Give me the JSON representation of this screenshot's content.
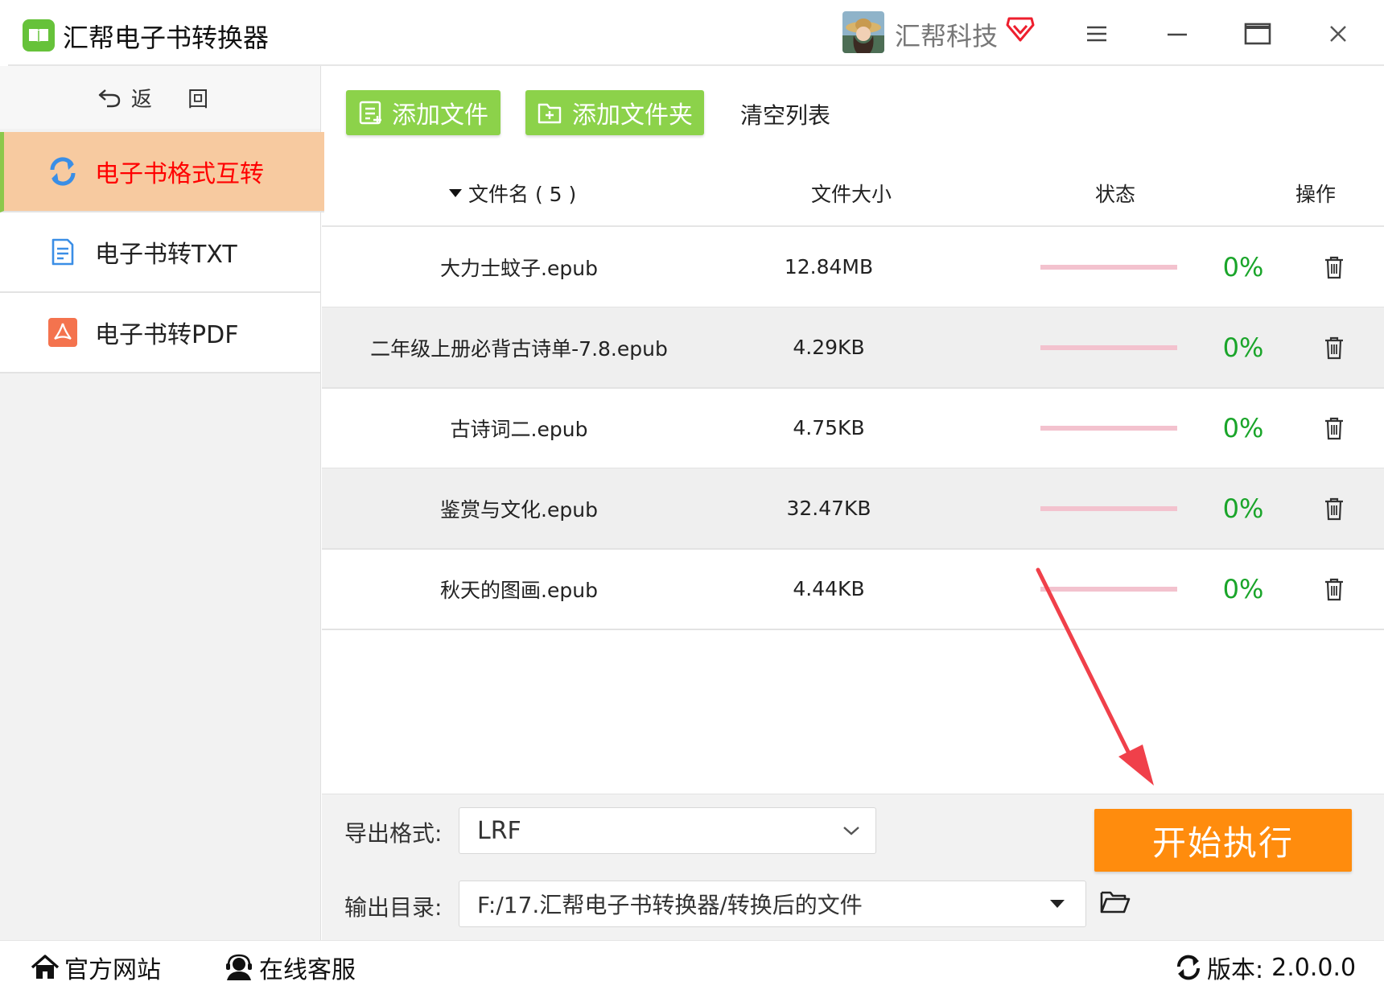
{
  "app": {
    "title": "汇帮电子书转换器",
    "brand_name": "汇帮科技",
    "accent_color": "#8cd24a",
    "highlight_color": "#ff8c0d"
  },
  "sidebar": {
    "back_label": "返 回",
    "items": [
      {
        "label": "电子书格式互转",
        "icon": "refresh-icon",
        "active": true
      },
      {
        "label": "电子书转TXT",
        "icon": "document-icon",
        "active": false
      },
      {
        "label": "电子书转PDF",
        "icon": "pdf-icon",
        "active": false
      }
    ]
  },
  "toolbar": {
    "add_file": "添加文件",
    "add_folder": "添加文件夹",
    "clear_list": "清空列表"
  },
  "table": {
    "headers": {
      "name": "文件名 ( 5 )",
      "size": "文件大小",
      "status": "状态",
      "action": "操作"
    },
    "rows": [
      {
        "name": "大力士蚊子.epub",
        "size": "12.84MB",
        "progress": 0,
        "percent": "0%"
      },
      {
        "name": "二年级上册必背古诗单-7.8.epub",
        "size": "4.29KB",
        "progress": 0,
        "percent": "0%"
      },
      {
        "name": "古诗词二.epub",
        "size": "4.75KB",
        "progress": 0,
        "percent": "0%"
      },
      {
        "name": "鉴赏与文化.epub",
        "size": "32.47KB",
        "progress": 0,
        "percent": "0%"
      },
      {
        "name": "秋天的图画.epub",
        "size": "4.44KB",
        "progress": 0,
        "percent": "0%"
      }
    ]
  },
  "output": {
    "format_label": "导出格式:",
    "format_value": "LRF",
    "dir_label": "输出目录:",
    "dir_value": "F:/17.汇帮电子书转换器/转换后的文件",
    "start_label": "开始执行"
  },
  "statusbar": {
    "website": "官方网站",
    "support": "在线客服",
    "version_label": "版本:",
    "version_value": "2.0.0.0"
  }
}
